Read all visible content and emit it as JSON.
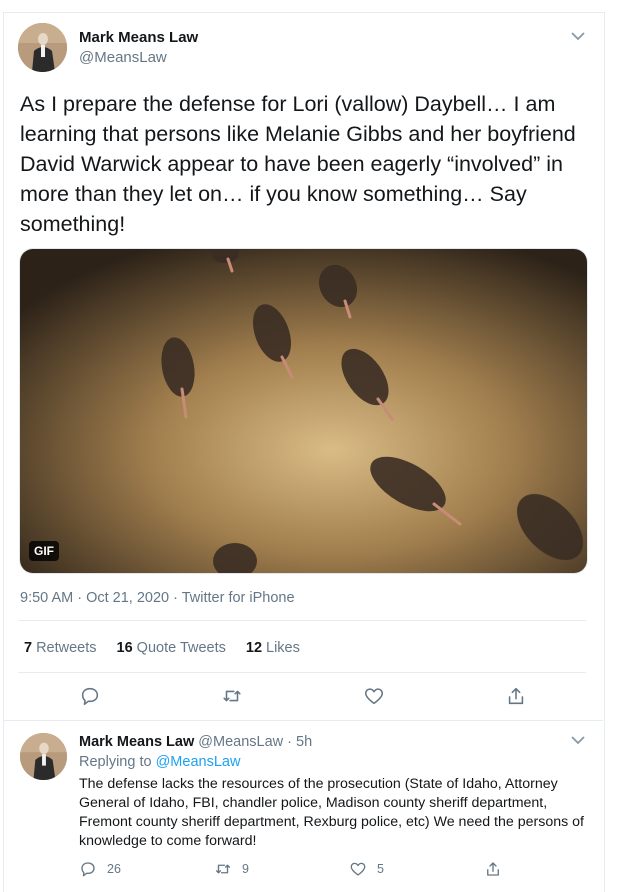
{
  "tweet": {
    "author_name": "Mark Means Law",
    "author_handle": "@MeansLaw",
    "text": "As I prepare the defense for Lori (vallow) Daybell… I am learning that persons like Melanie Gibbs and her boyfriend David Warwick appear to have been eagerly “involved” in more than they let on… if you know something… Say something!",
    "media_badge": "GIF",
    "meta": "9:50 AM · Oct 21, 2020 · Twitter for iPhone",
    "stats": {
      "retweets_count": "7",
      "retweets_label": "Retweets",
      "quotes_count": "16",
      "quotes_label": "Quote Tweets",
      "likes_count": "12",
      "likes_label": "Likes"
    },
    "actions": [
      "reply-icon",
      "retweet-icon",
      "like-icon",
      "share-icon"
    ]
  },
  "reply": {
    "author_name": "Mark Means Law",
    "author_handle": "@MeansLaw",
    "time": "· 5h",
    "replying_prefix": "Replying to",
    "replying_to": "@MeansLaw",
    "text": "The defense lacks the resources of the prosecution (State of Idaho, Attorney General of Idaho, FBI, chandler police, Madison county sheriff department, Fremont county sheriff department, Rexburg police, etc) We need the persons of knowledge to come forward!",
    "reply_count": "26",
    "retweet_count": "9",
    "like_count": "5"
  },
  "colors": {
    "accent": "#1da1f2",
    "secondary_text": "#657786",
    "divider": "#e6ecf0"
  }
}
